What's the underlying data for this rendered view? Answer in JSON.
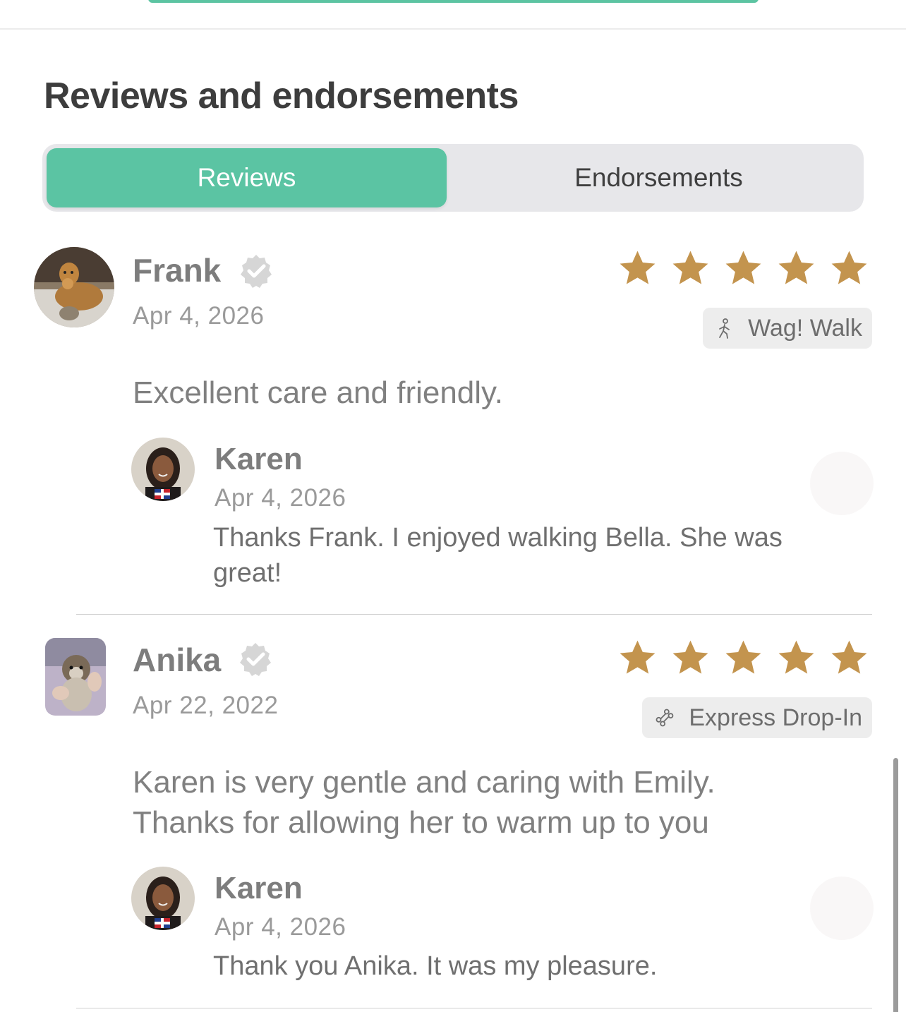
{
  "section": {
    "title": "Reviews and endorsements"
  },
  "tabs": [
    {
      "label": "Reviews",
      "selected": true
    },
    {
      "label": "Endorsements",
      "selected": false
    }
  ],
  "colors": {
    "accent": "#5bc4a3",
    "star": "#c3944e",
    "verified": "#d6d6d6"
  },
  "reviews": [
    {
      "reviewer": "Frank",
      "verified": true,
      "date": "Apr 4, 2026",
      "rating": 5,
      "service": "Wag! Walk",
      "service_icon": "walking-person-icon",
      "text": "Excellent care and friendly.",
      "reply": {
        "name": "Karen",
        "date": "Apr 4, 2026",
        "text": "Thanks Frank. I enjoyed walking Bella. She was great!"
      }
    },
    {
      "reviewer": "Anika",
      "verified": true,
      "date": "Apr 22, 2022",
      "rating": 5,
      "service": "Express Drop-In",
      "service_icon": "dog-bone-icon",
      "text": "Karen is very gentle and caring with Emily. Thanks for allowing her to warm up to you",
      "reply": {
        "name": "Karen",
        "date": "Apr 4, 2026",
        "text": "Thank you Anika. It was my pleasure."
      }
    }
  ]
}
